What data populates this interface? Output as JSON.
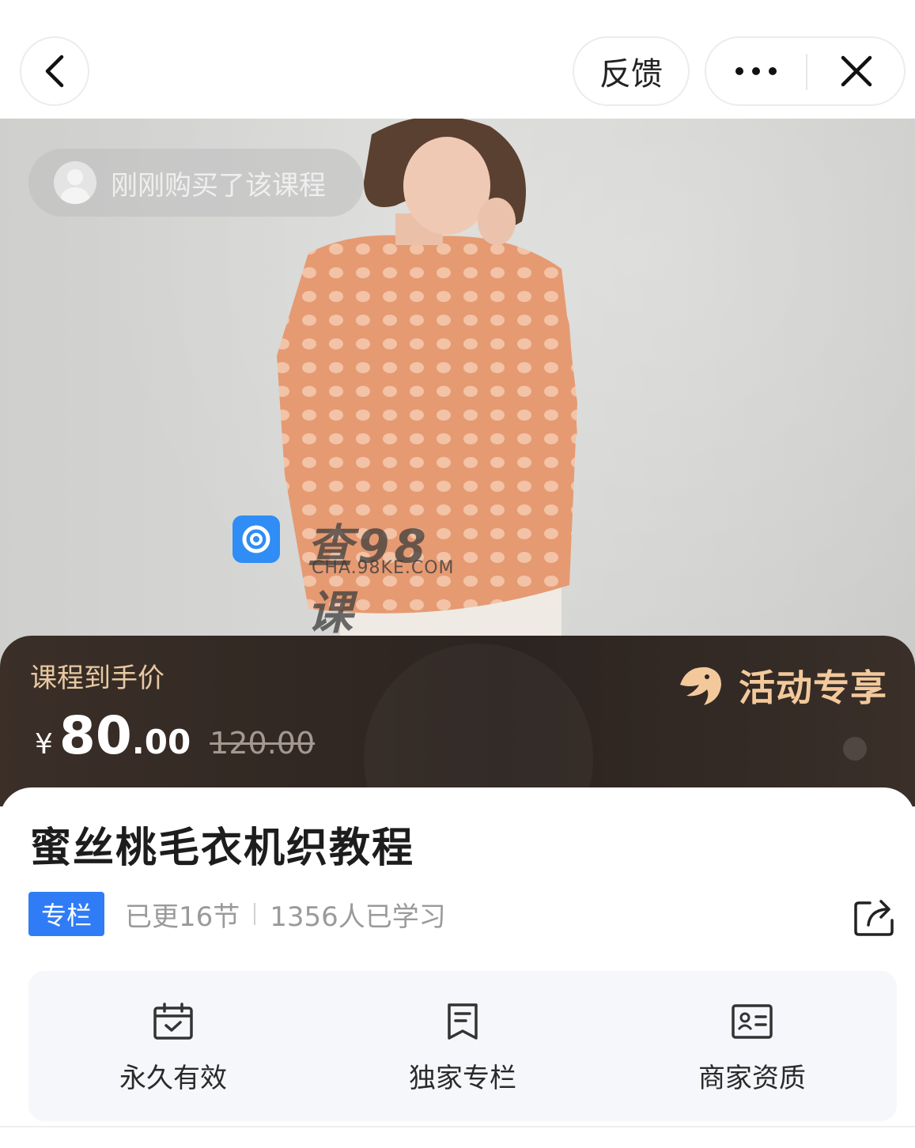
{
  "topbar": {
    "feedback_label": "反馈",
    "icons": [
      "back-arrow-icon",
      "more-dots-icon",
      "close-icon"
    ]
  },
  "hero": {
    "buy_toast": "刚刚购买了该课程",
    "watermark_cn": "查98课",
    "watermark_en": "CHA.98KE.COM"
  },
  "price": {
    "label": "课程到手价",
    "currency": "¥",
    "integer": "80",
    "decimal": ".00",
    "original": "120.00",
    "promo_label": "活动专享",
    "promo_color": "#f3c99c"
  },
  "course": {
    "title": "蜜丝桃毛衣机织教程",
    "tag": "专栏",
    "tag_color": "#2f7cf6",
    "updates": "已更16节",
    "learners": "1356人已学习"
  },
  "features": [
    {
      "label": "永久有效",
      "icon": "calendar-check-icon"
    },
    {
      "label": "独家专栏",
      "icon": "bookmark-doc-icon"
    },
    {
      "label": "商家资质",
      "icon": "id-card-icon"
    }
  ]
}
